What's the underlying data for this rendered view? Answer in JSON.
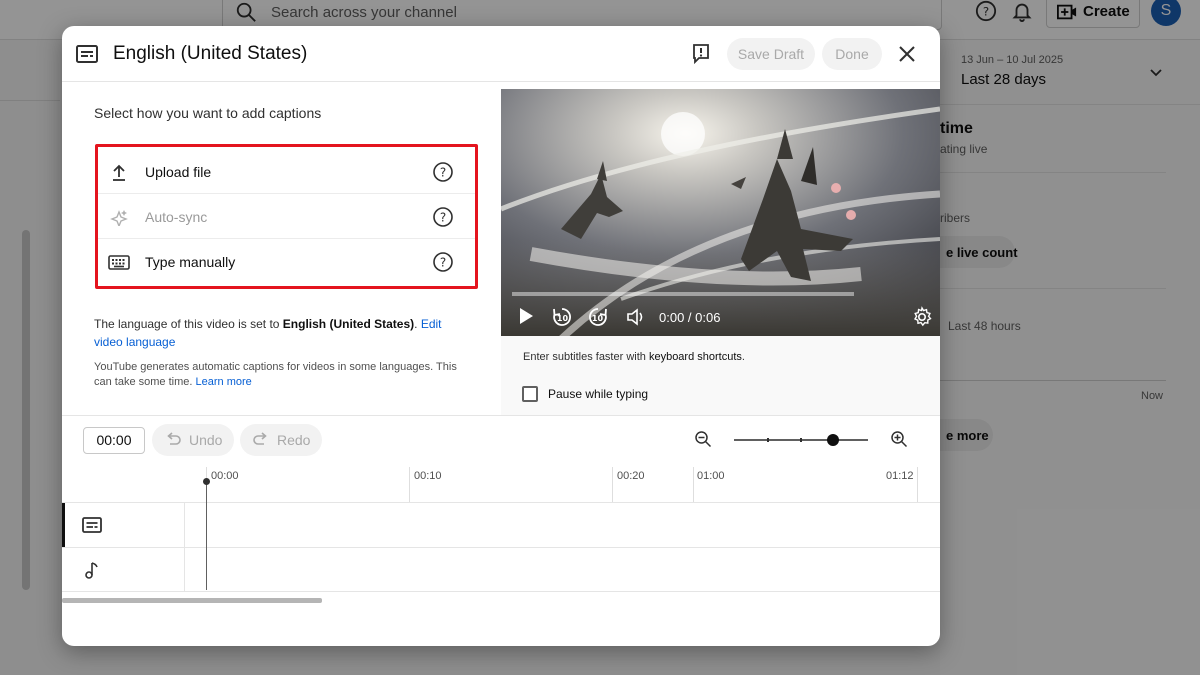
{
  "background": {
    "search_placeholder": "Search across your channel",
    "create_label": "Create",
    "avatar_letter": "S",
    "date_range": "13 Jun – 10 Jul 2025",
    "period": "Last 28 days",
    "card_heading_fragment": "time",
    "card_sub_fragment": "ating live",
    "subscribers_fragment": "ribers",
    "live_count_fragment": "e live count",
    "last48_label": "Last 48 hours",
    "now_label": "Now",
    "see_more_fragment": "e more"
  },
  "dialog": {
    "title": "English (United States)",
    "save_draft_label": "Save Draft",
    "done_label": "Done"
  },
  "options": {
    "heading": "Select how you want to add captions",
    "items": [
      {
        "label": "Upload file",
        "icon": "upload-icon",
        "enabled": true
      },
      {
        "label": "Auto-sync",
        "icon": "sparkle-icon",
        "enabled": false
      },
      {
        "label": "Type manually",
        "icon": "keyboard-icon",
        "enabled": true
      }
    ],
    "lang_note_prefix": "The language of this video is set to ",
    "lang_note_language": "English (United States)",
    "lang_note_suffix": ". ",
    "lang_note_link": "Edit video language",
    "auto_note": "YouTube generates automatic captions for videos in some languages. This can take some time. ",
    "auto_note_link": "Learn more"
  },
  "video": {
    "time_display": "0:00 / 0:06",
    "kb_note_prefix": "Enter subtitles faster with ",
    "kb_note_bold": "keyboard shortcuts",
    "kb_note_suffix": ".",
    "pause_label": "Pause while typing"
  },
  "toolbar": {
    "time_value": "00:00",
    "undo_label": "Undo",
    "redo_label": "Redo",
    "zoom_level": 0.74
  },
  "timeline": {
    "ticks": [
      "00:00",
      "00:10",
      "00:20",
      "01:00",
      "01:12"
    ]
  },
  "colors": {
    "highlight_box": "#e4141e",
    "link": "#065fd4"
  }
}
